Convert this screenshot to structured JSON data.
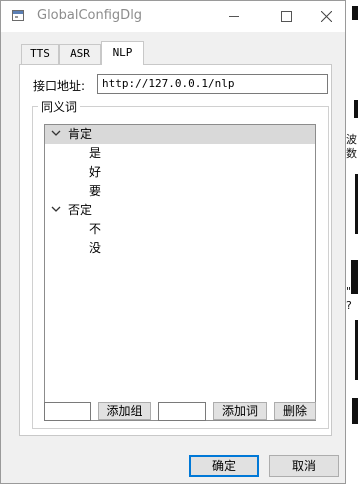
{
  "window": {
    "title": "GlobalConfigDlg"
  },
  "tabs": [
    {
      "label": "TTS",
      "active": false
    },
    {
      "label": "ASR",
      "active": false
    },
    {
      "label": "NLP",
      "active": true
    }
  ],
  "api": {
    "label": "接口地址:",
    "value": "http://127.0.0.1/nlp"
  },
  "synonyms": {
    "group_title": "同义词",
    "tree": [
      {
        "label": "肯定",
        "expanded": true,
        "selected": true,
        "children": [
          "是",
          "好",
          "要"
        ]
      },
      {
        "label": "否定",
        "expanded": true,
        "selected": false,
        "children": [
          "不",
          "没"
        ]
      }
    ],
    "group_input_value": "",
    "add_group_label": "添加组",
    "word_input_value": "",
    "add_word_label": "添加词",
    "delete_label": "删除"
  },
  "footer": {
    "ok_label": "确定",
    "cancel_label": "取消"
  },
  "background": {
    "snippets": [
      "波",
      "数",
      "?",
      "\""
    ]
  },
  "colors": {
    "accent": "#0078d7",
    "selected_row": "#d9d9d9",
    "window_bg": "#f0f0f0"
  }
}
